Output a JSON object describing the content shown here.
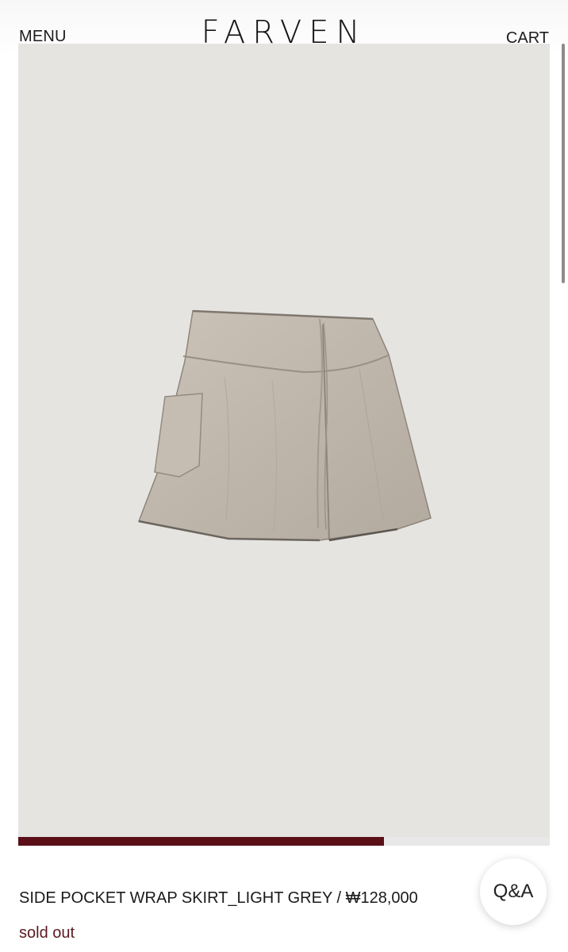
{
  "header": {
    "menu_label": "MENU",
    "brand": "FARVEN",
    "cart_label": "CART"
  },
  "product": {
    "image_icon": "skirt-photo",
    "title_price": "SIDE POCKET WRAP SKIRT_LIGHT GREY / ₩128,000",
    "status": "sold out"
  },
  "gallery": {
    "progress_fraction": 0.688,
    "progress_color": "#5a0f18"
  },
  "qa": {
    "label": "Q&A"
  },
  "colors": {
    "image_background": "#e5e4e1",
    "skirt_fabric": "#c2b9ae",
    "sold_out_text": "#5a1a20"
  }
}
